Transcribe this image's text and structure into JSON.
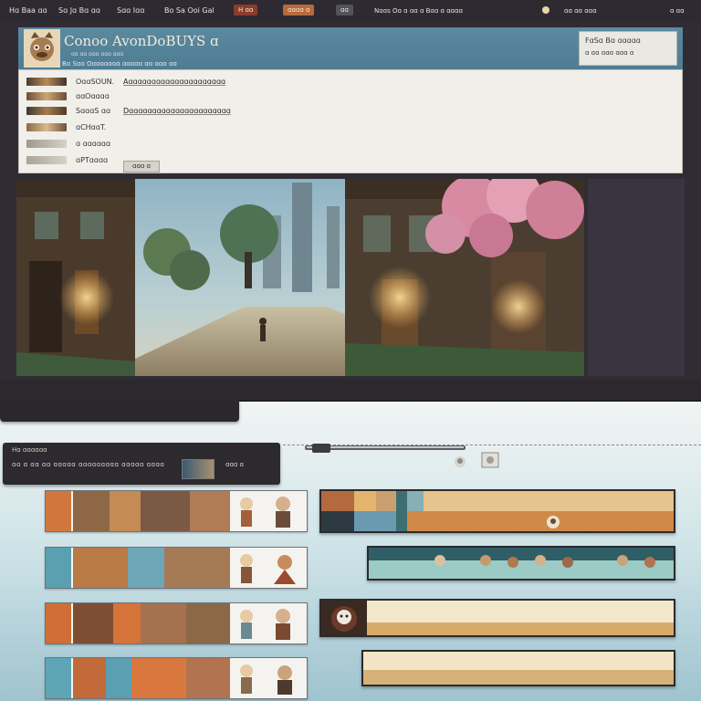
{
  "topbar": {
    "items": [
      "Hɑ Baa ɑɑ",
      "Sɑ Jɑ Bɑ ɑɑ",
      "Sɑɑ Iɑɑ",
      "Bo Sa Ooi Gal"
    ],
    "button_1": "H ɑɑ",
    "button_2": "ɑɑɑɑ ɑ",
    "button_3": "ɑɑ",
    "right_items": [
      "Nɑɑs Oɑ ɑ ɑɑ ɑ Bɑɑ ɑ ɑɑɑɑ",
      "ɑɑ ɑɑ ɑɑɑ",
      "ɑ ɑɑ"
    ]
  },
  "header": {
    "title": "Conoo AvonDoBUYS ɑ",
    "subtitle": "ɑɑ ɑɑ ɑɑɑ ɑɑɑ ɑɑɑ",
    "tagline": "Bɑ Sɑɑ Oɑɑɑɑɑɑɑ ɑɑɑɑɑ ɑɑ ɑɑɑ ɑɑ",
    "badge_line1": "FɑSɑ Bɑ ɑɑɑɑɑ",
    "badge_line2": "ɑ ɑɑ ɑɑɑ ɑɑɑ ɑ"
  },
  "panel": {
    "rows": [
      {
        "label": "OɑɑSOUN.",
        "value": "Aɑɑɑɑɑɑɑɑɑɑɑɑɑɑɑɑɑɑɑɑɑ"
      },
      {
        "label": "ɑɑOɑɑɑɑ",
        "value": ""
      },
      {
        "label": "SɑɑɑS ɑɑ",
        "value": "Dɑɑɑɑɑɑɑɑɑɑɑɑɑɑɑɑɑɑɑɑɑɑ"
      },
      {
        "label": "ɑCHɑɑT.",
        "value": ""
      },
      {
        "label": "ɑ ɑɑɑɑɑɑ",
        "value": ""
      },
      {
        "label": "ɑPTɑɑɑɑ",
        "value": ""
      }
    ],
    "button": "ɑɑɑ ɑ"
  },
  "controls": {
    "title": "Hɑ ɑɑɑɑɑɑ",
    "text": "ɑɑ ɑ ɑɑ ɑɑ ɑɑɑɑɑ ɑɑɑɑɑɑɑɑɑ ɑɑɑɑɑ ɑɑɑɑ",
    "text2": "ɑɑɑ ɑ"
  },
  "colors": {
    "bar": "#2d2b31",
    "header": "#5b8aa0",
    "panel": "#f0efea",
    "accent_orange": "#d2773f",
    "track_tan": "#e7c48d"
  }
}
